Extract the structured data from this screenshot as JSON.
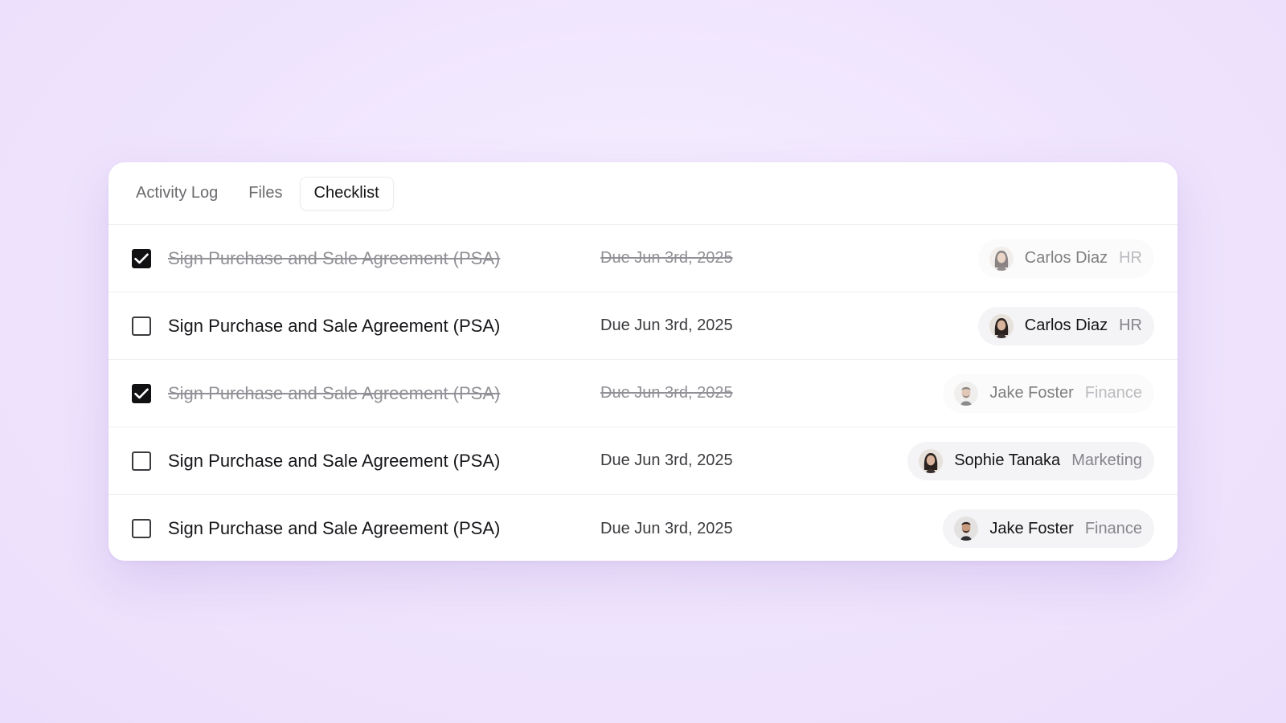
{
  "tabs": [
    {
      "label": "Activity Log",
      "active": false
    },
    {
      "label": "Files",
      "active": false
    },
    {
      "label": "Checklist",
      "active": true
    }
  ],
  "checklist": [
    {
      "task": "Sign Purchase and Sale Agreement (PSA)",
      "due": "Due Jun 3rd, 2025",
      "done": true,
      "assignee": {
        "name": "Carlos Diaz",
        "dept": "HR",
        "avatar": "woman-avatar-icon"
      }
    },
    {
      "task": "Sign Purchase and Sale Agreement (PSA)",
      "due": "Due Jun 3rd, 2025",
      "done": false,
      "assignee": {
        "name": "Carlos Diaz",
        "dept": "HR",
        "avatar": "woman-avatar-icon"
      }
    },
    {
      "task": "Sign Purchase and Sale Agreement (PSA)",
      "due": "Due Jun 3rd, 2025",
      "done": true,
      "assignee": {
        "name": "Jake Foster",
        "dept": "Finance",
        "avatar": "man-avatar-icon"
      }
    },
    {
      "task": "Sign Purchase and Sale Agreement (PSA)",
      "due": "Due Jun 3rd, 2025",
      "done": false,
      "assignee": {
        "name": "Sophie Tanaka",
        "dept": "Marketing",
        "avatar": "woman-avatar-icon"
      }
    },
    {
      "task": "Sign Purchase and Sale Agreement (PSA)",
      "due": "Due Jun 3rd, 2025",
      "done": false,
      "assignee": {
        "name": "Jake Foster",
        "dept": "Finance",
        "avatar": "man-avatar-icon"
      }
    }
  ],
  "colors": {
    "checked_fill": "#111113",
    "text_primary": "#151517",
    "text_muted": "#909096",
    "pill_bg": "#f4f3f6"
  }
}
